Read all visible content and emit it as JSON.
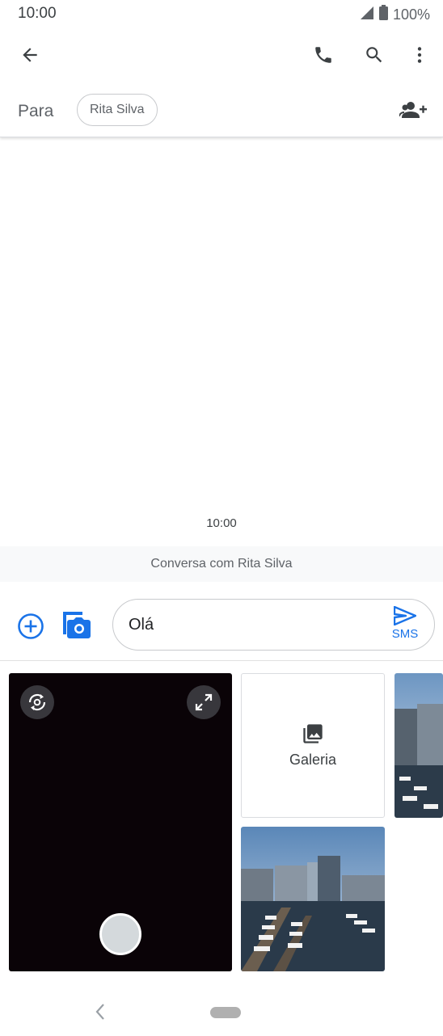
{
  "status_bar": {
    "time": "10:00",
    "battery": "100%"
  },
  "app_bar": {
    "back_icon": "arrow-back-icon",
    "call_icon": "phone-icon",
    "search_icon": "search-icon",
    "more_icon": "more-vert-icon"
  },
  "recipients": {
    "label": "Para",
    "chips": [
      "Rita Silva"
    ],
    "add_icon": "add-person-icon"
  },
  "conversation": {
    "timestamp": "10:00",
    "banner": "Conversa com Rita Silva"
  },
  "compose": {
    "text": "Olá",
    "send_label": "SMS"
  },
  "media_picker": {
    "gallery_label": "Galeria"
  },
  "colors": {
    "accent": "#1a73e8",
    "camera_bg": "#0a0307"
  }
}
